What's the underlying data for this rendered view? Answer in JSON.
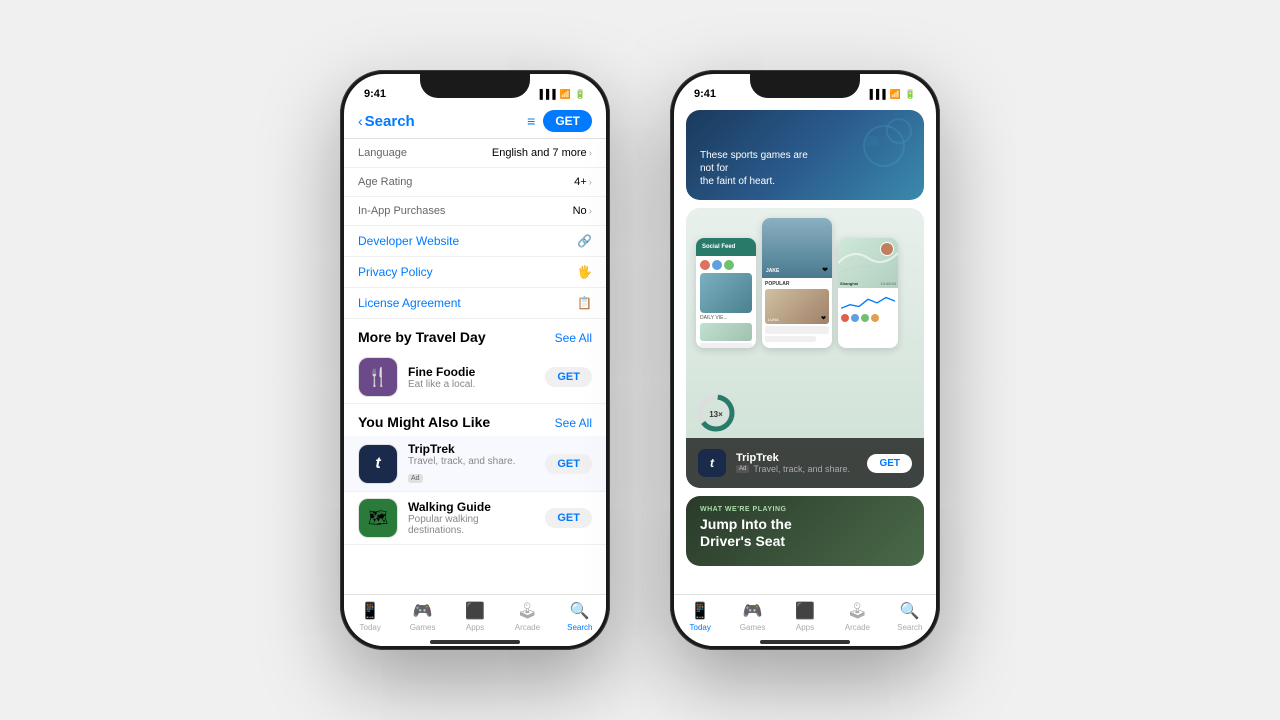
{
  "background_color": "#f0f0f0",
  "phone1": {
    "status_time": "9:41",
    "nav": {
      "back_label": "Search",
      "get_button": "GET",
      "list_icon": "list-icon"
    },
    "info_rows": [
      {
        "label": "Language",
        "value": "English and 7 more"
      },
      {
        "label": "Age Rating",
        "value": "4+"
      },
      {
        "label": "In-App Purchases",
        "value": "No"
      }
    ],
    "links": [
      {
        "text": "Developer Website",
        "icon": "🔗"
      },
      {
        "text": "Privacy Policy",
        "icon": "🖐"
      },
      {
        "text": "License Agreement",
        "icon": "📋"
      }
    ],
    "more_by": {
      "title": "More by Travel Day",
      "see_all": "See All",
      "apps": [
        {
          "name": "Fine Foodie",
          "subtitle": "Eat like a local.",
          "get": "GET"
        }
      ]
    },
    "also_like": {
      "title": "You Might Also Like",
      "see_all": "See All",
      "apps": [
        {
          "name": "TripTrek",
          "subtitle": "Travel, track, and share.",
          "ad": "Ad",
          "get": "GET"
        },
        {
          "name": "Walking Guide",
          "subtitle": "Popular walking destinations.",
          "get": "GET"
        }
      ]
    },
    "tabs": [
      {
        "label": "Today",
        "icon": "📱",
        "active": false
      },
      {
        "label": "Games",
        "icon": "🎮",
        "active": false
      },
      {
        "label": "Apps",
        "icon": "⬛",
        "active": false
      },
      {
        "label": "Arcade",
        "icon": "🕹",
        "active": false
      },
      {
        "label": "Search",
        "icon": "🔍",
        "active": true
      }
    ]
  },
  "phone2": {
    "status_time": "9:41",
    "cards": [
      {
        "type": "sports",
        "text": "These sports games are not for\nthe faint of heart."
      },
      {
        "type": "social",
        "app_name": "TripTrek",
        "app_desc": "Travel, track, and share.",
        "get": "GET",
        "ad": "Ad"
      },
      {
        "type": "driver",
        "subtitle": "WHAT WE'RE PLAYING",
        "title": "Jump Into the\nDriver's Seat"
      }
    ],
    "tabs": [
      {
        "label": "Today",
        "icon": "📱",
        "active": true
      },
      {
        "label": "Games",
        "icon": "🎮",
        "active": false
      },
      {
        "label": "Apps",
        "icon": "⬛",
        "active": false
      },
      {
        "label": "Arcade",
        "icon": "🕹",
        "active": false
      },
      {
        "label": "Search",
        "icon": "🔍",
        "active": false
      }
    ]
  }
}
